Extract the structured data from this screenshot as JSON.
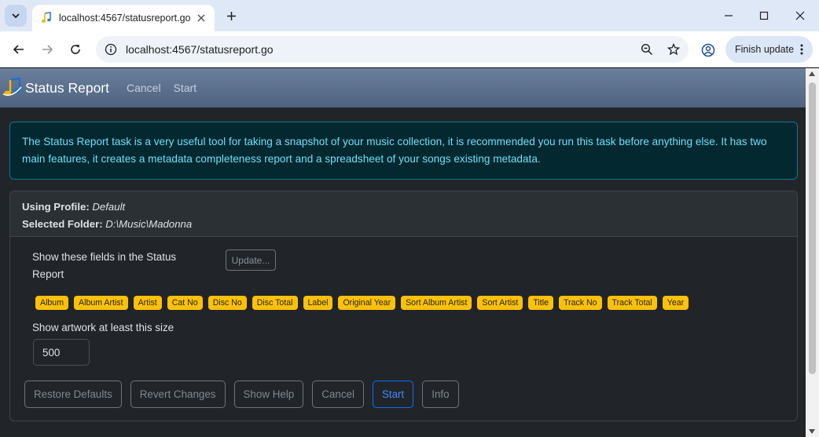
{
  "browser": {
    "tab_title": "localhost:4567/statusreport.go",
    "url": "localhost:4567/statusreport.go",
    "finish_update_label": "Finish update"
  },
  "navbar": {
    "brand": "Status Report",
    "links": [
      "Cancel",
      "Start"
    ]
  },
  "intro": "The Status Report task is a very useful tool for taking a snapshot of your music collection, it is recommended you run this task before anything else. It has two main features, it creates a metadata completeness report and a spreadsheet of your songs existing metadata.",
  "card": {
    "profile_label": "Using Profile:",
    "profile_value": "Default",
    "folder_label": "Selected Folder:",
    "folder_value": "D:\\Music\\Madonna",
    "fields_label": "Show these fields in the Status Report",
    "update_button": "Update...",
    "fields": [
      "Album",
      "Album Artist",
      "Artist",
      "Cat No",
      "Disc No",
      "Disc Total",
      "Label",
      "Original Year",
      "Sort Album Artist",
      "Sort Artist",
      "Title",
      "Track No",
      "Track Total",
      "Year"
    ],
    "artwork_label": "Show artwork at least this size",
    "artwork_value": "500",
    "buttons": [
      "Restore Defaults",
      "Revert Changes",
      "Show Help",
      "Cancel",
      "Start",
      "Info"
    ]
  },
  "colors": {
    "accent": "#0d6efd",
    "tag": "#ffc107",
    "alert_text": "#6edff6"
  }
}
